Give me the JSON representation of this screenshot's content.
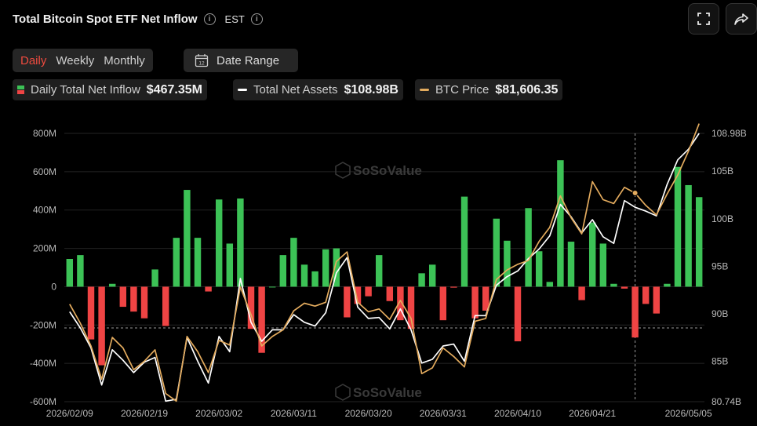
{
  "header": {
    "title": "Total Bitcoin Spot ETF Net Inflow",
    "timezone": "EST"
  },
  "toolbar": {
    "fullscreen_icon": "fullscreen-icon",
    "share_icon": "share-icon"
  },
  "range_tabs": [
    {
      "label": "Daily",
      "active": true
    },
    {
      "label": "Weekly",
      "active": false
    },
    {
      "label": "Monthly",
      "active": false
    }
  ],
  "date_range": {
    "label": "Date Range",
    "icon": "calendar-icon",
    "icon_text": "12"
  },
  "legend": [
    {
      "label": "Daily Total Net Inflow",
      "value": "$467.35M",
      "kind": "bar"
    },
    {
      "label": "Total Net Assets",
      "value": "$108.98B",
      "kind": "line",
      "color": "#ffffff"
    },
    {
      "label": "BTC Price",
      "value": "$81,606.35",
      "kind": "line",
      "color": "#e3ab5e"
    }
  ],
  "watermark": "SoSoValue",
  "colors": {
    "positive": "#3cc256",
    "negative": "#ef4444",
    "assets_line": "#ffffff",
    "price_line": "#e3ab5e"
  },
  "chart_data": {
    "type": "bar",
    "title": "Total Bitcoin Spot ETF Net Inflow",
    "y_left": {
      "range": [
        -600,
        800
      ],
      "unit": "M",
      "ticks": [
        "800M",
        "600M",
        "400M",
        "200M",
        "0",
        "-200M",
        "-400M",
        "-600M"
      ],
      "tick_values": [
        800,
        600,
        400,
        200,
        0,
        -200,
        -400,
        -600
      ]
    },
    "y_right": {
      "range": [
        80.74,
        108.98
      ],
      "ticks": [
        "108.98B",
        "105B",
        "100B",
        "95B",
        "90B",
        "85B",
        "80.74B"
      ],
      "tick_values": [
        108.98,
        105,
        100,
        95,
        90,
        85,
        80.74
      ]
    },
    "x_tick_labels": [
      {
        "label": "2026/02/09",
        "index": 0
      },
      {
        "label": "2026/02/19",
        "index": 7
      },
      {
        "label": "2026/03/02",
        "index": 14
      },
      {
        "label": "2026/03/11",
        "index": 21
      },
      {
        "label": "2026/03/20",
        "index": 28
      },
      {
        "label": "2026/03/31",
        "index": 35
      },
      {
        "label": "2026/04/10",
        "index": 42
      },
      {
        "label": "2026/04/21",
        "index": 49
      },
      {
        "label": "2026/05/05",
        "index": 58
      }
    ],
    "reference_line_value": -215,
    "crosshair_index": 53,
    "series": [
      {
        "name": "Daily Total Net Inflow",
        "type": "bar",
        "values": [
          145,
          165,
          -275,
          -410,
          15,
          -105,
          -130,
          -165,
          90,
          -205,
          255,
          505,
          255,
          -25,
          455,
          225,
          460,
          -220,
          -345,
          0,
          165,
          255,
          115,
          80,
          195,
          200,
          -160,
          -90,
          -50,
          165,
          -75,
          -175,
          -220,
          70,
          115,
          -175,
          -5,
          470,
          -165,
          -125,
          355,
          240,
          -285,
          410,
          185,
          25,
          660,
          235,
          -70,
          335,
          225,
          15,
          -10,
          -265,
          -90,
          -140,
          15,
          625,
          530,
          467.35
        ]
      },
      {
        "name": "Total Net Assets",
        "type": "line",
        "values": [
          90.2,
          88.5,
          86.4,
          82.5,
          86.2,
          85.1,
          83.8,
          84.9,
          85.4,
          80.8,
          81.0,
          87.5,
          85.0,
          82.7,
          87.6,
          86.0,
          93.7,
          89.1,
          87.1,
          88.3,
          88.3,
          89.9,
          89.1,
          88.7,
          90.1,
          94.3,
          95.9,
          90.7,
          89.5,
          89.6,
          88.4,
          90.5,
          88.3,
          84.8,
          85.2,
          86.6,
          86.8,
          85.0,
          89.8,
          89.8,
          93.0,
          93.9,
          94.5,
          95.8,
          96.8,
          98.2,
          101.5,
          100.2,
          98.5,
          99.9,
          98.1,
          97.4,
          101.9,
          101.2,
          100.8,
          100.3,
          103.6,
          106.2,
          107.3,
          108.98
        ]
      },
      {
        "name": "BTC Price",
        "type": "line",
        "values": [
          91.0,
          89.0,
          86.6,
          83.1,
          87.5,
          86.4,
          84.1,
          85.0,
          86.2,
          81.6,
          80.8,
          87.6,
          86.0,
          83.8,
          87.2,
          86.7,
          92.8,
          89.9,
          86.6,
          87.6,
          88.3,
          90.3,
          91.1,
          90.8,
          91.2,
          95.5,
          96.5,
          91.2,
          90.2,
          90.5,
          89.4,
          91.4,
          89.5,
          83.7,
          84.3,
          86.4,
          85.5,
          84.4,
          89.2,
          89.5,
          93.6,
          94.6,
          95.2,
          95.6,
          97.6,
          99.1,
          102.4,
          100.1,
          98.4,
          103.9,
          102.0,
          101.6,
          103.3,
          102.7,
          101.4,
          100.4,
          102.6,
          104.6,
          107.1,
          110.0
        ]
      }
    ]
  }
}
